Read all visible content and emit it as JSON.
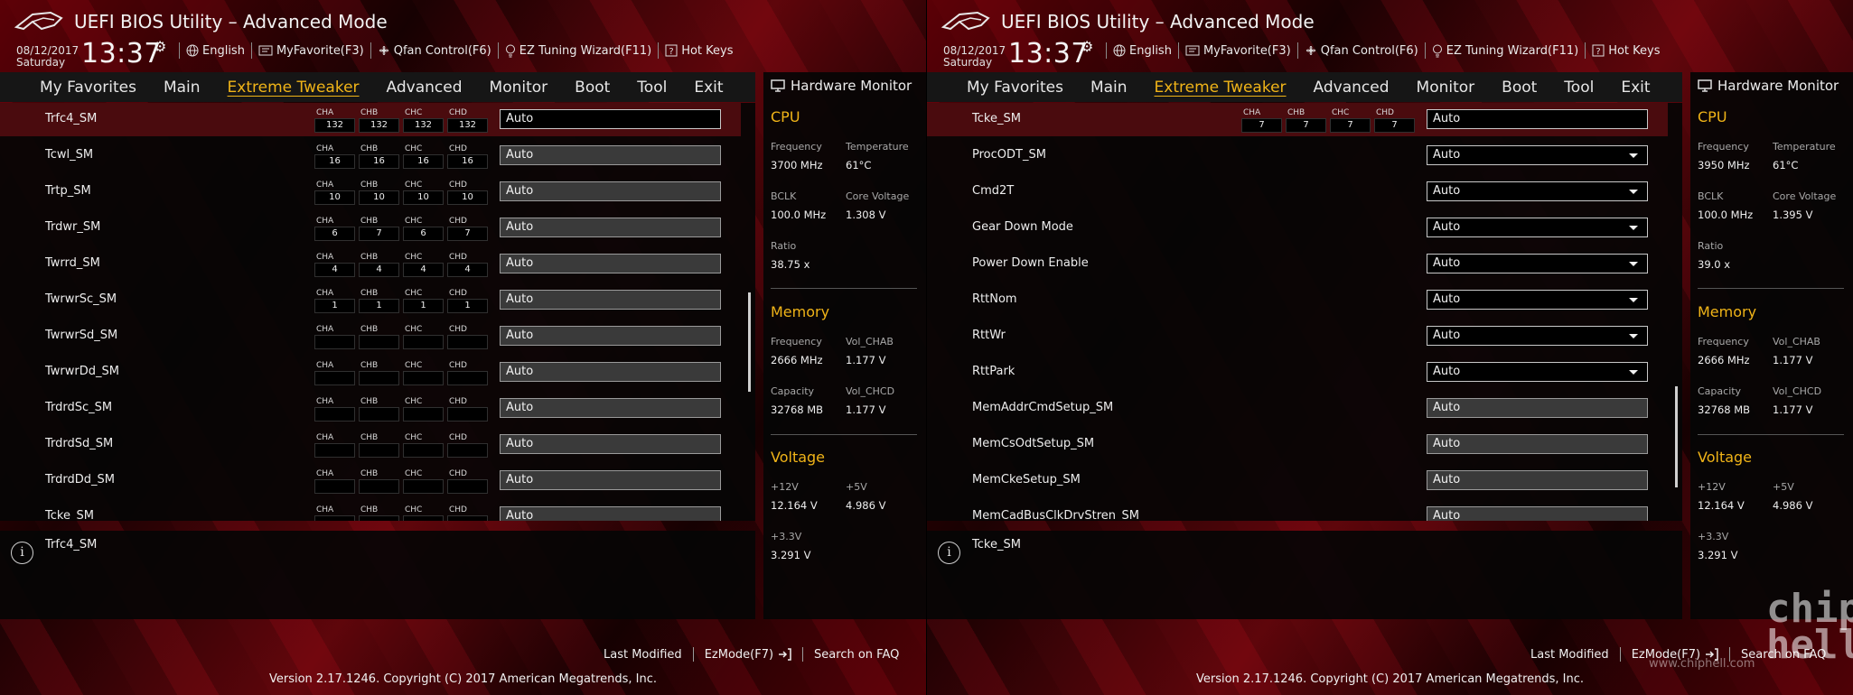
{
  "app_title": "UEFI BIOS Utility – Advanced Mode",
  "colors": {
    "accent": "#f0b418",
    "selected_row": "#4a0b0e",
    "panel_bg": "#050505",
    "brand_red": "#8a0a12"
  },
  "icons": {
    "logo": "rog-logo-icon",
    "gear": "gear-icon",
    "language": "globe-icon",
    "favorite": "myfavorite-icon",
    "qfan": "fan-icon",
    "tuning": "lightbulb-icon",
    "hotkeys": "help-box-icon",
    "monitor": "monitor-icon",
    "info": "info-icon",
    "ezmode": "exit-arrow-icon"
  },
  "left": {
    "date": "08/12/2017",
    "day": "Saturday",
    "time": "13:37",
    "toolbar": {
      "language": "English",
      "myfavorite": "MyFavorite(F3)",
      "qfan": "Qfan Control(F6)",
      "ez_tuning": "EZ Tuning Wizard(F11)",
      "hotkeys": "Hot Keys"
    },
    "nav": [
      "My Favorites",
      "Main",
      "Extreme Tweaker",
      "Advanced",
      "Monitor",
      "Boot",
      "Tool",
      "Exit"
    ],
    "ch_names": [
      "CHA",
      "CHB",
      "CHC",
      "CHD"
    ],
    "rows": [
      {
        "label": "Trfc4_SM",
        "ch": [
          "132",
          "132",
          "132",
          "132"
        ],
        "value": "Auto"
      },
      {
        "label": "Tcwl_SM",
        "ch": [
          "16",
          "16",
          "16",
          "16"
        ],
        "value": "Auto"
      },
      {
        "label": "Trtp_SM",
        "ch": [
          "10",
          "10",
          "10",
          "10"
        ],
        "value": "Auto"
      },
      {
        "label": "Trdwr_SM",
        "ch": [
          "6",
          "7",
          "6",
          "7"
        ],
        "value": "Auto"
      },
      {
        "label": "Twrrd_SM",
        "ch": [
          "4",
          "4",
          "4",
          "4"
        ],
        "value": "Auto"
      },
      {
        "label": "TwrwrSc_SM",
        "ch": [
          "1",
          "1",
          "1",
          "1"
        ],
        "value": "Auto"
      },
      {
        "label": "TwrwrSd_SM",
        "ch": [
          "",
          "",
          "",
          ""
        ],
        "value": "Auto"
      },
      {
        "label": "TwrwrDd_SM",
        "ch": [
          "",
          "",
          "",
          ""
        ],
        "value": "Auto"
      },
      {
        "label": "TrdrdSc_SM",
        "ch": [
          "",
          "",
          "",
          ""
        ],
        "value": "Auto"
      },
      {
        "label": "TrdrdSd_SM",
        "ch": [
          "",
          "",
          "",
          ""
        ],
        "value": "Auto"
      },
      {
        "label": "TrdrdDd_SM",
        "ch": [
          "",
          "",
          "",
          ""
        ],
        "value": "Auto"
      },
      {
        "label": "Tcke_SM",
        "ch": [
          "",
          "",
          "",
          ""
        ],
        "value": "Auto"
      }
    ],
    "help": "Trfc4_SM",
    "hw": {
      "title": "Hardware Monitor",
      "cpu": {
        "section": "CPU",
        "freq_label": "Frequency",
        "freq": "3700 MHz",
        "temp_label": "Temperature",
        "temp": "61°C",
        "bclk_label": "BCLK",
        "bclk": "100.0 MHz",
        "vcore_label": "Core Voltage",
        "vcore": "1.308 V",
        "ratio_label": "Ratio",
        "ratio": "38.75 x"
      },
      "memory": {
        "section": "Memory",
        "freq_label": "Frequency",
        "freq": "2666 MHz",
        "vchab_label": "Vol_CHAB",
        "vchab": "1.177 V",
        "cap_label": "Capacity",
        "cap": "32768 MB",
        "vchcd_label": "Vol_CHCD",
        "vchcd": "1.177 V"
      },
      "voltage": {
        "section": "Voltage",
        "v12_label": "+12V",
        "v12": "12.164 V",
        "v5_label": "+5V",
        "v5": "4.986 V",
        "v33_label": "+3.3V",
        "v33": "3.291 V"
      }
    }
  },
  "right": {
    "date": "08/12/2017",
    "day": "Saturday",
    "time": "13:37",
    "toolbar": {
      "language": "English",
      "myfavorite": "MyFavorite(F3)",
      "qfan": "Qfan Control(F6)",
      "ez_tuning": "EZ Tuning Wizard(F11)",
      "hotkeys": "Hot Keys"
    },
    "nav": [
      "My Favorites",
      "Main",
      "Extreme Tweaker",
      "Advanced",
      "Monitor",
      "Boot",
      "Tool",
      "Exit"
    ],
    "ch_names": [
      "CHA",
      "CHB",
      "CHC",
      "CHD"
    ],
    "tcke": {
      "label": "Tcke_SM",
      "ch": [
        "7",
        "7",
        "7",
        "7"
      ],
      "value": "Auto"
    },
    "rows": [
      {
        "label": "ProcODT_SM",
        "value": "Auto"
      },
      {
        "label": "Cmd2T",
        "value": "Auto"
      },
      {
        "label": "Gear Down Mode",
        "value": "Auto"
      },
      {
        "label": "Power Down Enable",
        "value": "Auto"
      },
      {
        "label": "RttNom",
        "value": "Auto"
      },
      {
        "label": "RttWr",
        "value": "Auto"
      },
      {
        "label": "RttPark",
        "value": "Auto"
      },
      {
        "label": "MemAddrCmdSetup_SM",
        "value": "Auto"
      },
      {
        "label": "MemCsOdtSetup_SM",
        "value": "Auto"
      },
      {
        "label": "MemCkeSetup_SM",
        "value": "Auto"
      },
      {
        "label": "MemCadBusClkDrvStren_SM",
        "value": "Auto"
      }
    ],
    "help": "Tcke_SM",
    "hw": {
      "title": "Hardware Monitor",
      "cpu": {
        "section": "CPU",
        "freq_label": "Frequency",
        "freq": "3950 MHz",
        "temp_label": "Temperature",
        "temp": "61°C",
        "bclk_label": "BCLK",
        "bclk": "100.0 MHz",
        "vcore_label": "Core Voltage",
        "vcore": "1.395 V",
        "ratio_label": "Ratio",
        "ratio": "39.0 x"
      },
      "memory": {
        "section": "Memory",
        "freq_label": "Frequency",
        "freq": "2666 MHz",
        "vchab_label": "Vol_CHAB",
        "vchab": "1.177 V",
        "cap_label": "Capacity",
        "cap": "32768 MB",
        "vchcd_label": "Vol_CHCD",
        "vchcd": "1.177 V"
      },
      "voltage": {
        "section": "Voltage",
        "v12_label": "+12V",
        "v12": "12.164 V",
        "v5_label": "+5V",
        "v5": "4.986 V",
        "v33_label": "+3.3V",
        "v33": "3.291 V"
      }
    }
  },
  "footer": {
    "last_modified": "Last Modified",
    "ezmode": "EzMode(F7)",
    "search": "Search on FAQ",
    "version": "Version 2.17.1246. Copyright (C) 2017 American Megatrends, Inc."
  },
  "watermark": {
    "logo": "chip hell",
    "url": "www.chiphell.com"
  }
}
